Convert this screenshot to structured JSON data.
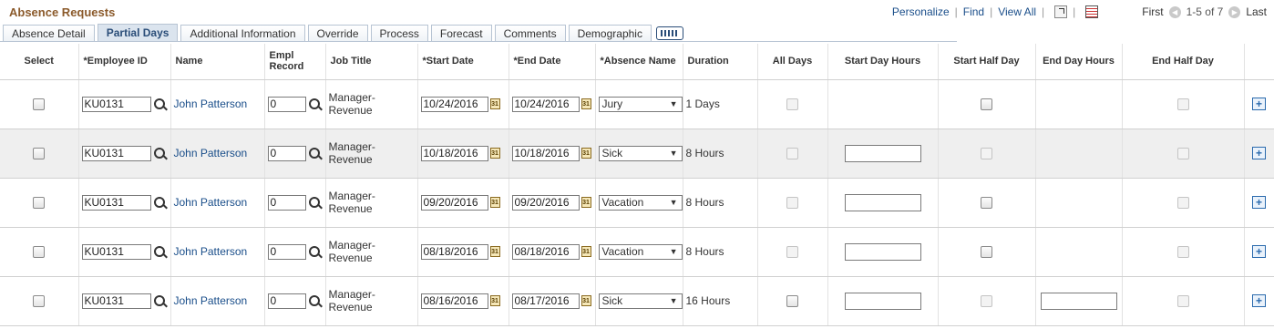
{
  "header": {
    "title": "Absence Requests",
    "personalize": "Personalize",
    "find": "Find",
    "view_all": "View All",
    "first": "First",
    "count": "1-5 of 7",
    "last": "Last"
  },
  "tabs": [
    {
      "label": "Absence Detail"
    },
    {
      "label": "Partial Days"
    },
    {
      "label": "Additional Information"
    },
    {
      "label": "Override"
    },
    {
      "label": "Process"
    },
    {
      "label": "Forecast"
    },
    {
      "label": "Comments"
    },
    {
      "label": "Demographic"
    }
  ],
  "columns": {
    "select": "Select",
    "employee_id": "*Employee ID",
    "name": "Name",
    "empl_record": "Empl Record",
    "job_title": "Job Title",
    "start_date": "*Start Date",
    "end_date": "*End Date",
    "absence_name": "*Absence Name",
    "duration": "Duration",
    "all_days": "All Days",
    "start_day_hours": "Start Day Hours",
    "start_half_day": "Start Half Day",
    "end_day_hours": "End Day Hours",
    "end_half_day": "End Half Day"
  },
  "rows": [
    {
      "employee_id": "KU0131",
      "name": "John Patterson",
      "empl_record": "0",
      "job_title": "Manager-Revenue",
      "start_date": "10/24/2016",
      "end_date": "10/24/2016",
      "absence_name": "Jury",
      "duration": "1 Days",
      "start_day_hours": "",
      "end_day_hours": ""
    },
    {
      "employee_id": "KU0131",
      "name": "John Patterson",
      "empl_record": "0",
      "job_title": "Manager-Revenue",
      "start_date": "10/18/2016",
      "end_date": "10/18/2016",
      "absence_name": "Sick",
      "duration": "8 Hours",
      "start_day_hours": "",
      "end_day_hours": ""
    },
    {
      "employee_id": "KU0131",
      "name": "John Patterson",
      "empl_record": "0",
      "job_title": "Manager-Revenue",
      "start_date": "09/20/2016",
      "end_date": "09/20/2016",
      "absence_name": "Vacation",
      "duration": "8 Hours",
      "start_day_hours": "",
      "end_day_hours": ""
    },
    {
      "employee_id": "KU0131",
      "name": "John Patterson",
      "empl_record": "0",
      "job_title": "Manager-Revenue",
      "start_date": "08/18/2016",
      "end_date": "08/18/2016",
      "absence_name": "Vacation",
      "duration": "8 Hours",
      "start_day_hours": "",
      "end_day_hours": ""
    },
    {
      "employee_id": "KU0131",
      "name": "John Patterson",
      "empl_record": "0",
      "job_title": "Manager-Revenue",
      "start_date": "08/16/2016",
      "end_date": "08/17/2016",
      "absence_name": "Sick",
      "duration": "16 Hours",
      "start_day_hours": "",
      "end_day_hours": ""
    }
  ],
  "icons": {
    "lookup": "magnifier-icon",
    "calendar": "calendar-icon",
    "add_row": "add-row-icon",
    "show_all_columns": "show-all-columns-icon"
  },
  "colors": {
    "title": "#8b5a2b",
    "link": "#1a4e8a",
    "active_tab": "#dbe4ee",
    "alt_row": "#efefef"
  }
}
